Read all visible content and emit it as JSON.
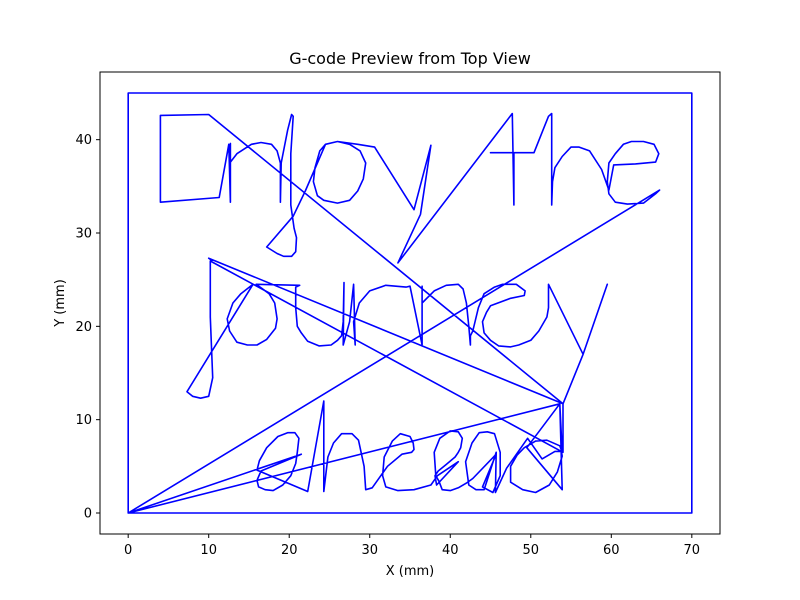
{
  "chart_data": {
    "type": "line",
    "title": "G-code Preview from Top View",
    "xlabel": "X (mm)",
    "ylabel": "Y (mm)",
    "xlim": [
      -3.5,
      73.5
    ],
    "ylim": [
      -2.25,
      47.25
    ],
    "xticks": [
      0,
      10,
      20,
      30,
      40,
      50,
      60,
      70
    ],
    "yticks": [
      0,
      10,
      20,
      30,
      40
    ],
    "grid": false,
    "series_color": "#0000ff",
    "series": [
      {
        "points": [
          [
            0,
            0
          ],
          [
            0,
            45
          ],
          [
            70,
            45
          ],
          [
            70,
            0
          ],
          [
            0,
            0
          ],
          [
            21.5,
            6.3
          ],
          [
            16.5,
            4.5
          ],
          [
            16.0,
            3.5
          ],
          [
            16.2,
            2.8
          ],
          [
            17.0,
            2.5
          ],
          [
            18.0,
            2.4
          ],
          [
            19.2,
            3.0
          ],
          [
            20.2,
            4.0
          ],
          [
            20.8,
            5.3
          ],
          [
            21.0,
            6.5
          ],
          [
            21.2,
            8.0
          ],
          [
            20.7,
            8.6
          ],
          [
            19.8,
            8.6
          ],
          [
            18.6,
            8.2
          ],
          [
            17.2,
            7.0
          ],
          [
            16.3,
            5.6
          ],
          [
            16.0,
            4.6
          ],
          [
            22.3,
            2.3
          ],
          [
            24.3,
            12.0
          ],
          [
            24.3,
            2.3
          ],
          [
            24.8,
            6.0
          ],
          [
            25.5,
            7.5
          ],
          [
            26.5,
            8.5
          ],
          [
            27.8,
            8.5
          ],
          [
            28.6,
            7.8
          ],
          [
            29.3,
            5.0
          ],
          [
            29.5,
            2.5
          ],
          [
            30.3,
            2.7
          ],
          [
            32.2,
            5.0
          ],
          [
            34.0,
            6.3
          ],
          [
            35.2,
            6.5
          ],
          [
            35.5,
            6.8
          ],
          [
            35.4,
            7.5
          ],
          [
            35.0,
            8.2
          ],
          [
            33.8,
            8.5
          ],
          [
            32.8,
            7.7
          ],
          [
            31.8,
            6.0
          ],
          [
            31.6,
            4.0
          ],
          [
            32.0,
            2.8
          ],
          [
            33.5,
            2.4
          ],
          [
            35.5,
            2.5
          ],
          [
            37.6,
            3.0
          ],
          [
            38.4,
            4.0
          ],
          [
            41.0,
            5.5
          ],
          [
            38.3,
            3.0
          ],
          [
            38.1,
            4.0
          ],
          [
            38.5,
            4.5
          ],
          [
            39.5,
            5.2
          ],
          [
            40.6,
            6.0
          ],
          [
            41.0,
            6.5
          ],
          [
            41.3,
            7.0
          ],
          [
            41.5,
            8.0
          ],
          [
            41.0,
            8.7
          ],
          [
            40.0,
            8.8
          ],
          [
            38.7,
            8.0
          ],
          [
            38.0,
            6.5
          ],
          [
            38.2,
            4.0
          ],
          [
            38.6,
            3.4
          ],
          [
            39.0,
            2.5
          ],
          [
            40.0,
            2.4
          ],
          [
            41.0,
            2.7
          ],
          [
            42.0,
            3.2
          ],
          [
            42.8,
            3.7
          ],
          [
            45.7,
            6.3
          ],
          [
            44.0,
            2.8
          ],
          [
            45.3,
            2.2
          ],
          [
            46.2,
            4.0
          ],
          [
            46.2,
            6.5
          ],
          [
            45.5,
            8.5
          ],
          [
            44.6,
            8.7
          ],
          [
            43.6,
            8.6
          ],
          [
            42.7,
            7.5
          ],
          [
            41.9,
            5.5
          ],
          [
            42.3,
            3.0
          ],
          [
            43.2,
            2.5
          ],
          [
            44.2,
            2.5
          ],
          [
            45.7,
            6.5
          ],
          [
            45.6,
            2.2
          ],
          [
            47.0,
            4.8
          ],
          [
            49.6,
            8.0
          ],
          [
            51.4,
            5.8
          ],
          [
            53.0,
            6.6
          ],
          [
            53.8,
            6.6
          ],
          [
            53.9,
            6.1
          ],
          [
            53.3,
            4.4
          ],
          [
            52.3,
            3.0
          ],
          [
            50.6,
            2.2
          ],
          [
            49.0,
            2.5
          ],
          [
            47.5,
            3.3
          ],
          [
            47.5,
            5.0
          ],
          [
            48.3,
            6.2
          ],
          [
            49.2,
            7.0
          ],
          [
            50.6,
            7.7
          ],
          [
            52.0,
            7.8
          ],
          [
            53.6,
            7.2
          ],
          [
            53.9,
            6.5
          ],
          [
            53.6,
            11.7
          ],
          [
            53.9,
            2.5
          ],
          [
            49.5,
            7.0
          ],
          [
            53.6,
            11.7
          ],
          [
            0,
            0
          ],
          [
            66.0,
            34.6
          ],
          [
            65.5,
            34.2
          ],
          [
            64.0,
            33.2
          ],
          [
            62.0,
            33.1
          ],
          [
            60.5,
            33.3
          ],
          [
            59.7,
            34.2
          ],
          [
            59.5,
            35.5
          ],
          [
            59.7,
            37.5
          ],
          [
            60.5,
            38.5
          ],
          [
            61.5,
            39.5
          ],
          [
            62.5,
            39.8
          ],
          [
            64.0,
            39.8
          ],
          [
            65.3,
            39.5
          ],
          [
            65.9,
            38.5
          ],
          [
            65.5,
            37.6
          ],
          [
            63.0,
            37.4
          ],
          [
            60.3,
            37.3
          ],
          [
            59.7,
            34.6
          ],
          [
            58.8,
            36.8
          ],
          [
            57.3,
            38.8
          ],
          [
            56.0,
            39.2
          ],
          [
            55.0,
            39.2
          ],
          [
            53.9,
            38.2
          ],
          [
            53.0,
            37.0
          ],
          [
            52.7,
            35.5
          ],
          [
            52.6,
            33.0
          ],
          [
            52.6,
            39.0
          ],
          [
            52.6,
            42.8
          ],
          [
            52.2,
            42.5
          ],
          [
            51.5,
            41.0
          ],
          [
            50.4,
            38.6
          ],
          [
            48.0,
            38.6
          ],
          [
            45.0,
            38.6
          ],
          [
            47.9,
            38.6
          ],
          [
            47.9,
            33.0
          ],
          [
            47.7,
            42.8
          ],
          [
            33.5,
            26.8
          ],
          [
            36.3,
            32.0
          ],
          [
            37.6,
            39.4
          ],
          [
            35.5,
            32.5
          ],
          [
            30.6,
            39.2
          ],
          [
            28.5,
            39.5
          ],
          [
            26.0,
            39.8
          ],
          [
            24.5,
            39.5
          ],
          [
            23.8,
            38.8
          ],
          [
            23.2,
            37.0
          ],
          [
            23.0,
            35.5
          ],
          [
            23.5,
            34.0
          ],
          [
            24.3,
            33.5
          ],
          [
            26.0,
            33.2
          ],
          [
            27.5,
            33.5
          ],
          [
            28.5,
            34.5
          ],
          [
            29.2,
            35.8
          ],
          [
            29.5,
            37.5
          ],
          [
            28.8,
            38.8
          ],
          [
            27.5,
            39.5
          ],
          [
            26.0,
            39.8
          ],
          [
            24.5,
            39.5
          ],
          [
            22.0,
            34.5
          ],
          [
            20.5,
            31.8
          ],
          [
            17.2,
            28.5
          ],
          [
            18.5,
            27.8
          ],
          [
            19.3,
            27.5
          ],
          [
            20.3,
            27.5
          ],
          [
            20.8,
            28.0
          ],
          [
            20.9,
            29.5
          ],
          [
            20.6,
            30.5
          ],
          [
            20.2,
            33.0
          ],
          [
            20.2,
            36.0
          ],
          [
            20.2,
            38.5
          ],
          [
            20.5,
            42.5
          ],
          [
            20.3,
            42.7
          ],
          [
            19.8,
            41.0
          ],
          [
            19.0,
            37.5
          ],
          [
            18.9,
            33.3
          ],
          [
            18.9,
            37.5
          ],
          [
            18.5,
            38.8
          ],
          [
            17.8,
            39.5
          ],
          [
            16.5,
            39.7
          ],
          [
            15.3,
            39.5
          ],
          [
            13.5,
            38.5
          ],
          [
            12.7,
            37.6
          ],
          [
            12.7,
            39.6
          ],
          [
            12.7,
            33.3
          ],
          [
            12.5,
            39.5
          ],
          [
            11.3,
            33.8
          ],
          [
            4.0,
            33.3
          ],
          [
            4.0,
            42.6
          ],
          [
            10.0,
            42.7
          ],
          [
            54.0,
            11.7
          ],
          [
            54.0,
            6.5
          ],
          [
            10.2,
            27.0
          ],
          [
            10.2,
            21.0
          ],
          [
            10.5,
            14.5
          ],
          [
            10.0,
            12.5
          ],
          [
            9.0,
            12.3
          ],
          [
            8.0,
            12.5
          ],
          [
            7.3,
            13.0
          ],
          [
            15.5,
            24.5
          ],
          [
            14.0,
            23.5
          ],
          [
            13.0,
            22.5
          ],
          [
            12.3,
            20.8
          ],
          [
            12.6,
            19.5
          ],
          [
            13.5,
            18.3
          ],
          [
            14.8,
            18.0
          ],
          [
            16.0,
            18.0
          ],
          [
            17.2,
            18.6
          ],
          [
            18.3,
            19.8
          ],
          [
            18.5,
            20.8
          ],
          [
            18.2,
            22.5
          ],
          [
            17.5,
            23.5
          ],
          [
            15.9,
            24.5
          ],
          [
            21.3,
            24.4
          ],
          [
            20.8,
            24.2
          ],
          [
            20.8,
            22.0
          ],
          [
            21.0,
            20.0
          ],
          [
            21.5,
            19.3
          ],
          [
            22.3,
            18.4
          ],
          [
            23.7,
            17.9
          ],
          [
            25.2,
            18.0
          ],
          [
            26.0,
            18.5
          ],
          [
            26.5,
            19.0
          ],
          [
            26.7,
            20.5
          ],
          [
            26.8,
            24.7
          ],
          [
            26.7,
            18.0
          ],
          [
            27.5,
            20.5
          ],
          [
            28.0,
            24.5
          ],
          [
            28.2,
            18.0
          ],
          [
            28.0,
            20.5
          ],
          [
            28.7,
            22.5
          ],
          [
            30.0,
            23.8
          ],
          [
            32.0,
            24.4
          ],
          [
            34.5,
            24.2
          ],
          [
            35.0,
            24.3
          ],
          [
            36.5,
            18.0
          ],
          [
            36.5,
            24.3
          ],
          [
            36.5,
            22.5
          ],
          [
            38.0,
            23.8
          ],
          [
            39.5,
            24.4
          ],
          [
            41.0,
            24.5
          ],
          [
            41.6,
            24.0
          ],
          [
            42.0,
            22.5
          ],
          [
            42.3,
            20.0
          ],
          [
            42.5,
            18.0
          ],
          [
            42.5,
            19.0
          ],
          [
            42.8,
            19.5
          ],
          [
            43.5,
            22.0
          ],
          [
            44.2,
            23.5
          ],
          [
            45.5,
            24.2
          ],
          [
            46.5,
            24.5
          ],
          [
            48.2,
            24.5
          ],
          [
            49.3,
            23.8
          ],
          [
            49.2,
            23.3
          ],
          [
            47.5,
            23.0
          ],
          [
            45.0,
            22.2
          ],
          [
            44.5,
            21.5
          ],
          [
            44.0,
            20.5
          ],
          [
            44.2,
            19.3
          ],
          [
            45.0,
            18.5
          ],
          [
            46.0,
            17.9
          ],
          [
            47.5,
            17.8
          ],
          [
            48.5,
            18.0
          ],
          [
            50.0,
            18.5
          ],
          [
            51.0,
            19.5
          ],
          [
            52.0,
            21.0
          ],
          [
            52.2,
            22.0
          ],
          [
            52.2,
            24.5
          ],
          [
            56.5,
            17.0
          ],
          [
            59.5,
            24.5
          ],
          [
            56.5,
            17.0
          ],
          [
            54.0,
            11.7
          ],
          [
            10.0,
            27.3
          ],
          [
            10.5,
            27.0
          ]
        ]
      }
    ]
  }
}
